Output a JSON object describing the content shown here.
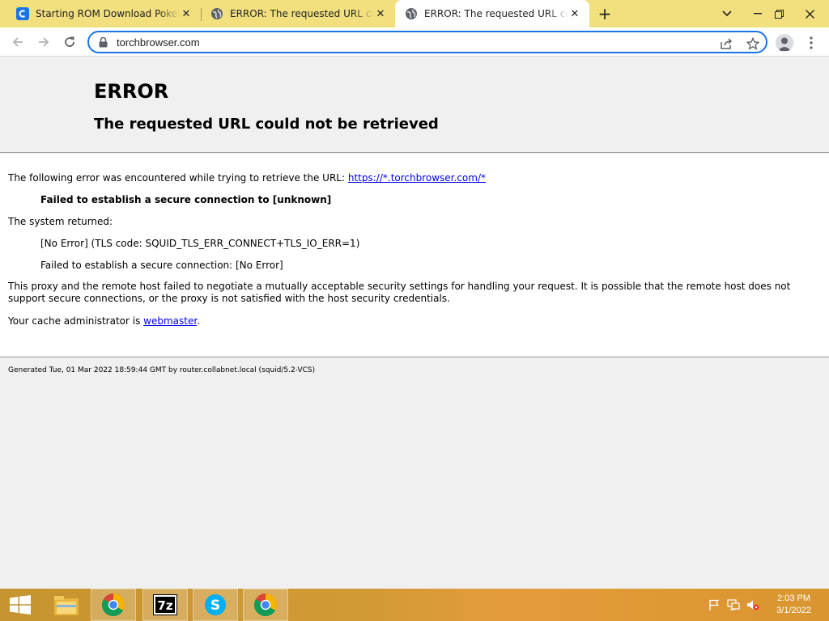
{
  "browser": {
    "tabs": [
      {
        "title": "Starting ROM Download Pokemo",
        "favicon": "torch-icon",
        "active": false
      },
      {
        "title": "ERROR: The requested URL could",
        "favicon": "globe-icon",
        "active": false
      },
      {
        "title": "ERROR: The requested URL could",
        "favicon": "globe-icon",
        "active": true
      }
    ],
    "new_tab": "+",
    "address": "torchbrowser.com"
  },
  "page": {
    "title": "ERROR",
    "subtitle": "The requested URL could not be retrieved",
    "intro_text": "The following error was encountered while trying to retrieve the URL:",
    "intro_link": "https://*.torchbrowser.com/*",
    "error_message": "Failed to establish a secure connection to [unknown]",
    "system_returned": "The system returned:",
    "tls_code": "[No Error] (TLS code: SQUID_TLS_ERR_CONNECT+TLS_IO_ERR=1)",
    "secure_failure": "Failed to establish a secure connection: [No Error]",
    "explanation": "This proxy and the remote host failed to negotiate a mutually acceptable security settings for handling your request. It is possible that the remote host does not support secure connections, or the proxy is not satisfied with the host security credentials.",
    "admin_prefix": "Your cache administrator is",
    "admin_link": "webmaster",
    "admin_suffix": ".",
    "footer": "Generated Tue, 01 Mar 2022 18:59:44 GMT by router.collabnet.local (squid/5.2-VCS)"
  },
  "taskbar": {
    "apps": [
      "chrome-icon",
      "7zip-icon",
      "skype-icon",
      "chrome-icon"
    ],
    "time": "2:03 PM",
    "date": "3/1/2022"
  },
  "colors": {
    "tabstrip": "#f2e07e",
    "accent": "#1a73e8",
    "link": "#0000ee",
    "taskbar": "#d29a34"
  }
}
